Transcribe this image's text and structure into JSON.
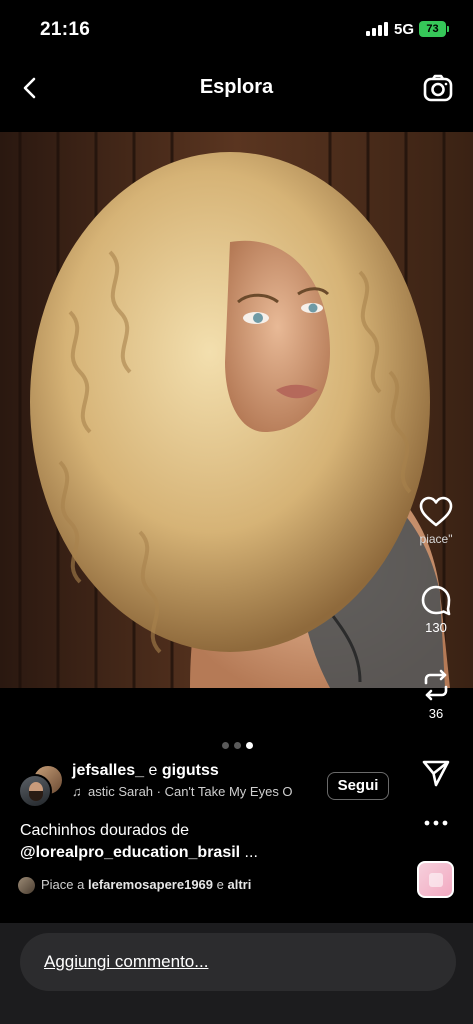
{
  "status_bar": {
    "time": "21:16",
    "network": "5G",
    "battery_level": "73"
  },
  "header": {
    "title": "Esplora",
    "back_icon": "chevron-left-icon",
    "camera_icon": "camera-icon"
  },
  "post": {
    "carousel": {
      "total": 3,
      "active_index": 3
    },
    "author": {
      "names_primary": "jefsalles_",
      "names_joiner": " e ",
      "names_secondary": "gigutss",
      "music": "astic Sarah · Can't Take My Eyes O"
    },
    "follow_label": "Segui",
    "caption": {
      "text": "Cachinhos dourados de",
      "mention": "@lorealpro_education_brasil",
      "more": " ..."
    },
    "likes": {
      "prefix": "Piace a ",
      "user": "lefaremosapere1969",
      "suffix": " e ",
      "others": "altri"
    },
    "actions": {
      "like_label": "piace\"",
      "comments": "130",
      "reposts": "36"
    }
  },
  "comment_bar": {
    "placeholder": "Aggiungi commento..."
  },
  "colors": {
    "background": "#000000",
    "battery": "#36c759",
    "comment_bar": "#1c1c1e"
  }
}
